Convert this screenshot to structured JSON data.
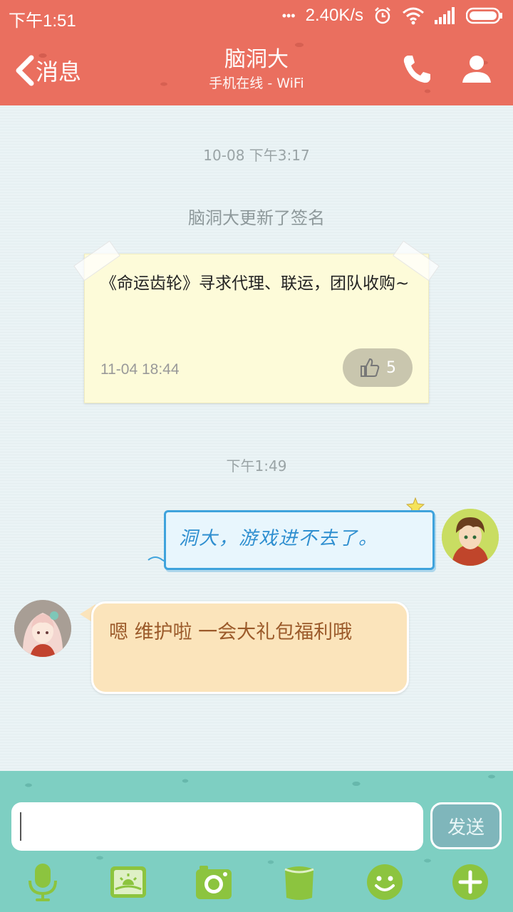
{
  "status_bar": {
    "time": "下午1:51",
    "dots": "•••",
    "network_speed": "2.40K/s",
    "icons": [
      "alarm-icon",
      "wifi-icon",
      "signal-icon",
      "battery-icon"
    ]
  },
  "header": {
    "back_label": "消息",
    "title": "脑洞大",
    "subtitle": "手机在线 - WiFi",
    "icons": [
      "chevron-left-icon",
      "phone-icon",
      "profile-icon"
    ]
  },
  "chat": {
    "timestamp_1": "10-08 下午3:17",
    "system_message": "脑洞大更新了签名",
    "signature_card": {
      "text": "《命运齿轮》寻求代理、联运，团队收购~",
      "time": "11-04 18:44",
      "likes": "5"
    },
    "timestamp_2": "下午1:49",
    "outgoing": {
      "text": "洞大，游戏进不去了。"
    },
    "incoming": {
      "text": "嗯 维护啦 一会大礼包福利哦"
    }
  },
  "composer": {
    "input_value": "",
    "send_label": "发送",
    "tools": [
      "microphone-icon",
      "image-icon",
      "camera-icon",
      "cup-icon",
      "emoji-icon",
      "plus-icon"
    ]
  },
  "colors": {
    "header_bg": "#ea6f5f",
    "bottom_bg": "#7ecfc2",
    "chat_bg": "#e9f3f4",
    "outgoing_border": "#3fa3dc",
    "incoming_bg": "#fbe4bb",
    "icon_green": "#8cc43f"
  }
}
